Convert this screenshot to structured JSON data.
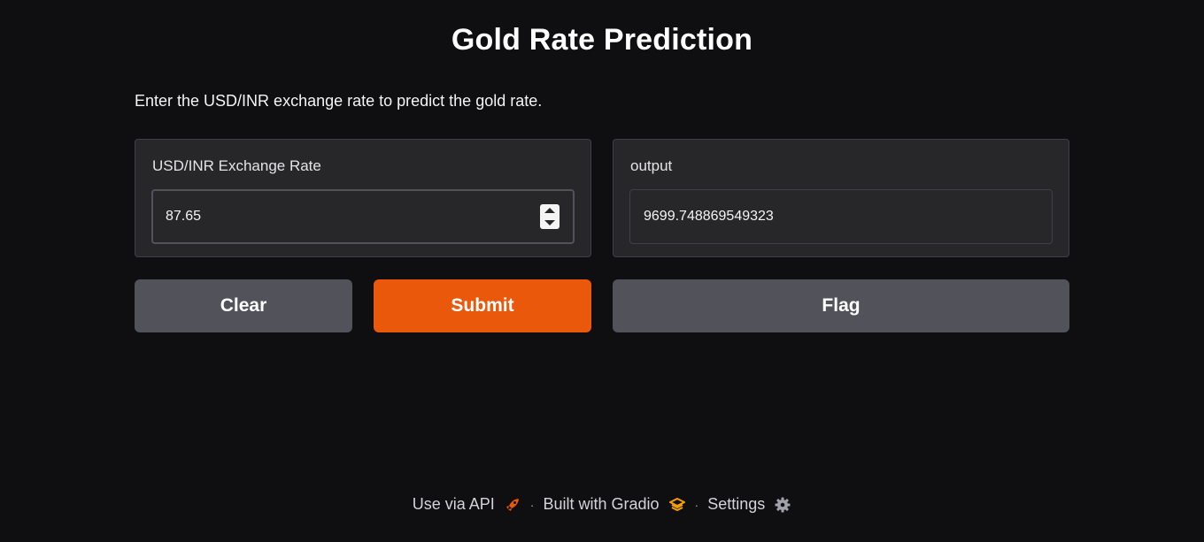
{
  "header": {
    "title": "Gold Rate Prediction",
    "description": "Enter the USD/INR exchange rate to predict the gold rate."
  },
  "input_panel": {
    "label": "USD/INR Exchange Rate",
    "value": "87.65"
  },
  "output_panel": {
    "label": "output",
    "value": "9699.748869549323"
  },
  "buttons": {
    "clear": "Clear",
    "submit": "Submit",
    "flag": "Flag"
  },
  "footer": {
    "api": "Use via API",
    "built_with": "Built with Gradio",
    "settings": "Settings",
    "separator": "·",
    "icons": [
      "rocket-icon",
      "gradio-logo-icon",
      "gear-icon"
    ]
  },
  "colors": {
    "background": "#0f0f12",
    "panel": "#27272a",
    "accent": "#ea580c",
    "secondary_button": "#52525b"
  }
}
